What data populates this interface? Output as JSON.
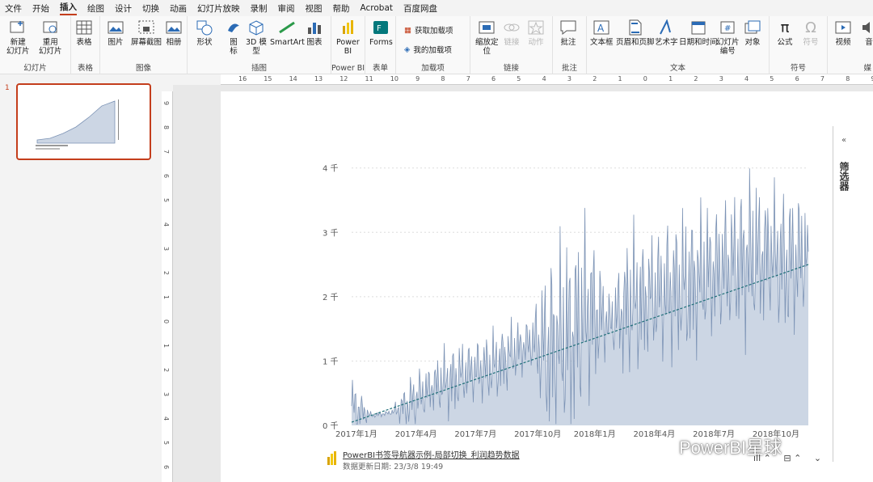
{
  "menu": {
    "tabs": [
      "文件",
      "开始",
      "插入",
      "绘图",
      "设计",
      "切换",
      "动画",
      "幻灯片放映",
      "录制",
      "审阅",
      "视图",
      "帮助",
      "Acrobat",
      "百度网盘"
    ],
    "active": "插入"
  },
  "ribbon": {
    "groups": {
      "slides": "幻灯片",
      "tables": "表格",
      "images": "图像",
      "illustrations": "插图",
      "powerbi": "Power BI",
      "forms": "表单",
      "addins": "加载项",
      "links": "链接",
      "comments": "批注",
      "text": "文本",
      "symbols": "符号",
      "media": "媒"
    },
    "buttons": {
      "new_slide": "新建\n幻灯片",
      "reuse_slide": "重用\n幻灯片",
      "table": "表格",
      "picture": "图片",
      "screenshot": "屏幕截图",
      "album": "相册",
      "shapes": "形状",
      "icons": "图\n标",
      "model3d": "3D 模\n型",
      "smartart": "SmartArt",
      "chart": "图表",
      "powerbi": "Power\nBI",
      "forms": "Forms",
      "get_addins": "获取加载项",
      "my_addins": "我的加载项",
      "zoom": "缩放定\n位",
      "link": "链接",
      "action": "动作",
      "comment": "批注",
      "textbox": "文本框",
      "header_footer": "页眉和页脚",
      "wordart": "艺术字",
      "datetime": "日期和时间",
      "slide_number": "幻灯片\n编号",
      "object": "对象",
      "equation": "公式",
      "symbol": "符号",
      "video": "视频",
      "audio": "音"
    }
  },
  "thumbnails": [
    {
      "number": "1"
    }
  ],
  "ruler_h": [
    "16",
    "15",
    "14",
    "13",
    "12",
    "11",
    "10",
    "9",
    "8",
    "7",
    "6",
    "5",
    "4",
    "3",
    "2",
    "1",
    "0",
    "1",
    "2",
    "3",
    "4",
    "5",
    "6",
    "7",
    "8",
    "9"
  ],
  "ruler_v": [
    "9",
    "8",
    "7",
    "6",
    "5",
    "4",
    "3",
    "2",
    "1",
    "0",
    "1",
    "2",
    "3",
    "4",
    "5",
    "6"
  ],
  "filter_pane": {
    "label": "筛选器",
    "collapse_glyph": "«"
  },
  "report": {
    "title": "PowerBI书签导航器示例-局部切换_利润趋势数据",
    "updated": "数据更新日期: 23/3/8 19:49"
  },
  "watermark": "PowerBI星球",
  "colors": {
    "accent": "#c43e1c",
    "line": "#7c93b5",
    "area": "#ccd6e4",
    "trend": "#1f6f78"
  },
  "chart_data": {
    "type": "area",
    "title": "",
    "xlabel": "",
    "ylabel": "",
    "y_ticks": [
      "0 千",
      "1 千",
      "2 千",
      "3 千",
      "4 千"
    ],
    "ylim": [
      0,
      4.6
    ],
    "x_ticks": [
      "2017年1月",
      "2017年4月",
      "2017年7月",
      "2017年10月",
      "2018年1月",
      "2018年4月",
      "2018年7月",
      "2018年10月"
    ],
    "x_tick_positions": [
      0,
      3,
      6,
      9,
      12,
      15,
      18,
      21
    ],
    "x": [
      "2017-01",
      "2017-02",
      "2017-03",
      "2017-04",
      "2017-05",
      "2017-06",
      "2017-07",
      "2017-08",
      "2017-09",
      "2017-10",
      "2017-11",
      "2017-12",
      "2018-01",
      "2018-02",
      "2018-03",
      "2018-04",
      "2018-05",
      "2018-06",
      "2018-07",
      "2018-08",
      "2018-09",
      "2018-10",
      "2018-11",
      "2018-12"
    ],
    "values": [
      0.3,
      0.15,
      0.2,
      0.35,
      0.6,
      0.7,
      0.85,
      0.9,
      1.1,
      1.3,
      1.2,
      1.4,
      1.8,
      1.6,
      1.9,
      2.0,
      2.1,
      2.2,
      2.4,
      2.5,
      2.6,
      2.7,
      2.5,
      2.7
    ],
    "peaks": [
      1.0,
      0.2,
      0.25,
      1.0,
      1.1,
      1.5,
      1.5,
      1.7,
      1.8,
      1.8,
      3.4,
      3.5,
      3.8,
      2.2,
      3.5,
      3.3,
      3.7,
      3.8,
      3.8,
      4.0,
      4.4,
      4.0,
      4.3,
      3.9
    ],
    "trend": [
      0.05,
      2.5
    ],
    "grid": true
  }
}
